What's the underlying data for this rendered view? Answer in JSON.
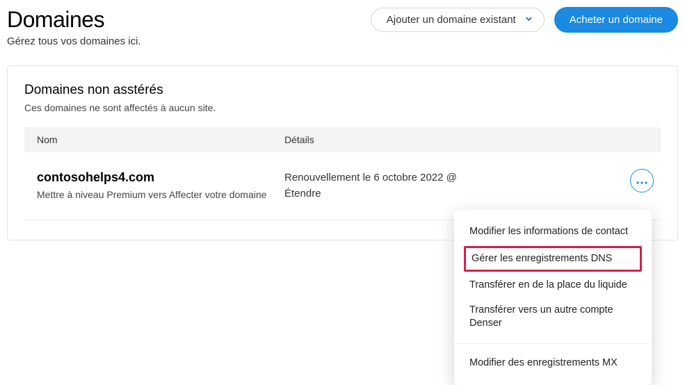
{
  "header": {
    "title": "Domaines",
    "subtitle": "Gérez tous vos domaines ici.",
    "add_existing_label": "Ajouter un domaine existant",
    "buy_label": "Acheter un domaine"
  },
  "section": {
    "title": "Domaines non asstérés",
    "subtitle": "Ces domaines ne sont affectés à aucun site."
  },
  "table": {
    "col_name": "Nom",
    "col_details": "Détails"
  },
  "rows": [
    {
      "domain": "contosohelps4.com",
      "subtext": "Mettre à niveau Premium vers Affecter votre domaine",
      "details_line1": "Renouvellement le 6 octobre 2022 @",
      "details_line2": "Étendre"
    }
  ],
  "menu": {
    "edit_contact": "Modifier les informations de contact",
    "manage_dns": "Gérer les enregistrements DNS",
    "transfer_instead": "Transférer en de la place du liquide",
    "transfer_account_l1": "Transférer vers un autre compte",
    "transfer_account_l2": "Denser",
    "edit_mx": "Modifier des enregistrements MX"
  }
}
